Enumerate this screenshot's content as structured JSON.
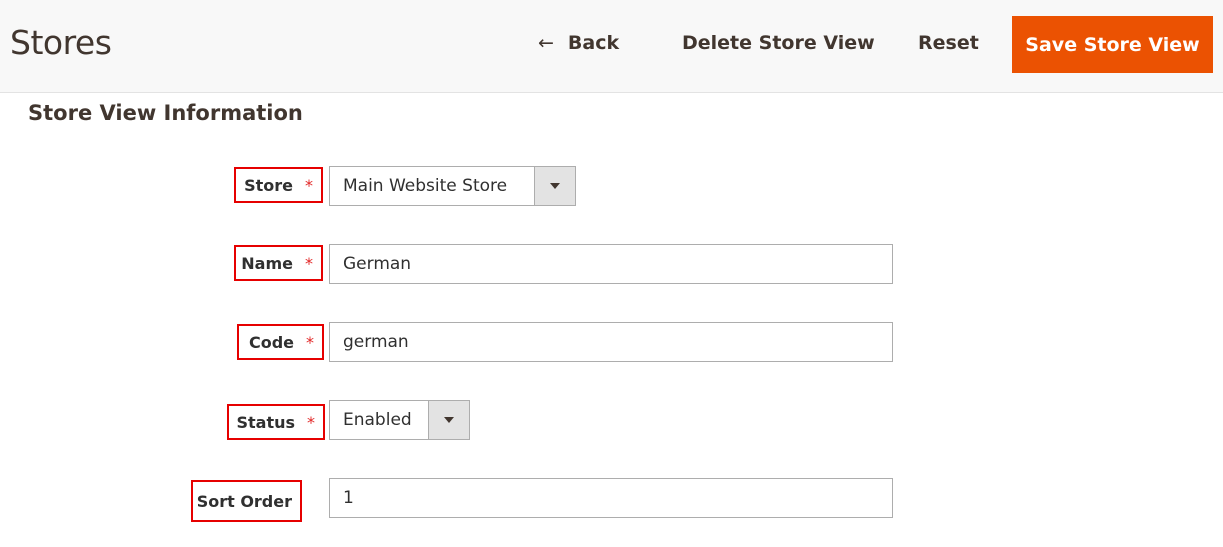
{
  "header": {
    "title": "Stores",
    "back_label": "Back",
    "back_icon": "arrow-left-icon",
    "delete_label": "Delete Store View",
    "reset_label": "Reset",
    "save_label": "Save Store View",
    "accent_color": "#eb5202"
  },
  "section": {
    "title": "Store View Information"
  },
  "form": {
    "required_mark": "*",
    "fields": [
      {
        "label": "Store",
        "value": "Main Website Store",
        "type": "select",
        "required": true
      },
      {
        "label": "Name",
        "value": "German",
        "type": "text",
        "required": true
      },
      {
        "label": "Code",
        "value": "german",
        "type": "text",
        "required": true
      },
      {
        "label": "Status",
        "value": "Enabled",
        "type": "select",
        "required": true
      },
      {
        "label": "Sort Order",
        "value": "1",
        "type": "text",
        "required": false
      }
    ]
  }
}
